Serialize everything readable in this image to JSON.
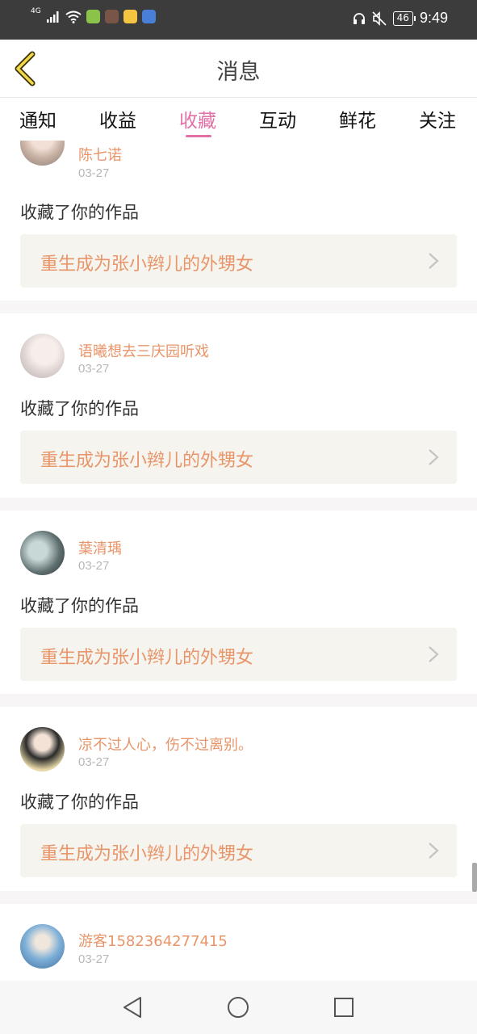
{
  "status_bar": {
    "network": "4G",
    "battery": "46",
    "time": "9:49",
    "icons": [
      "signal-icon",
      "wifi-icon",
      "app-notification-icon",
      "headset-icon",
      "mute-icon",
      "battery-icon"
    ]
  },
  "header": {
    "title": "消息",
    "back_icon": "chevron-left-icon",
    "accent_color": "#e26fa6"
  },
  "tabs": [
    {
      "label": "通知",
      "active": false
    },
    {
      "label": "收益",
      "active": false
    },
    {
      "label": "收藏",
      "active": true
    },
    {
      "label": "互动",
      "active": false
    },
    {
      "label": "鲜花",
      "active": false
    },
    {
      "label": "关注",
      "active": false
    }
  ],
  "messages": [
    {
      "username": "陈七诺",
      "date": "03-27",
      "action": "收藏了你的作品",
      "work_title": "重生成为张小辫儿的外甥女"
    },
    {
      "username": "语曦想去三庆园听戏",
      "date": "03-27",
      "action": "收藏了你的作品",
      "work_title": "重生成为张小辫儿的外甥女"
    },
    {
      "username": "葉清瑀",
      "date": "03-27",
      "action": "收藏了你的作品",
      "work_title": "重生成为张小辫儿的外甥女"
    },
    {
      "username": "凉不过人心，伤不过离别。",
      "date": "03-27",
      "action": "收藏了你的作品",
      "work_title": "重生成为张小辫儿的外甥女"
    },
    {
      "username": "游客1582364277415",
      "date": "03-27"
    }
  ],
  "nav_bar": {
    "icons": [
      "back-triangle-icon",
      "home-circle-icon",
      "recents-square-icon"
    ]
  }
}
